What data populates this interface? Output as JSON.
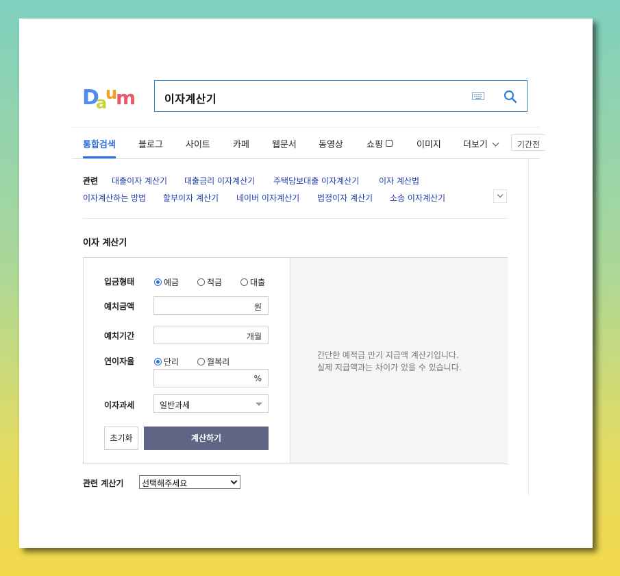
{
  "logo": {
    "text": "Daum",
    "colors": [
      "#4f8bf0",
      "#c9d43a",
      "#f0a020",
      "#4f8bf0",
      "#e85a6b"
    ]
  },
  "search": {
    "query": "이자계산기",
    "keyboard_icon": "keyboard-icon",
    "search_icon": "search-icon",
    "accent": "#2f86c9"
  },
  "tabs": [
    {
      "label": "통합검색",
      "active": true
    },
    {
      "label": "블로그"
    },
    {
      "label": "사이트"
    },
    {
      "label": "카페"
    },
    {
      "label": "웹문서"
    },
    {
      "label": "동영상"
    },
    {
      "label": "쇼핑"
    },
    {
      "label": "이미지"
    },
    {
      "label": "더보기"
    }
  ],
  "period_label": "기간전",
  "related": {
    "title": "관련",
    "links": [
      "대출이자 계산기",
      "대출금리 이자계산기",
      "주택담보대출 이자계산기",
      "이자 계산법",
      "이자계산하는 방법",
      "할부이자 계산기",
      "네이버 이자계산기",
      "법정이자 계산기",
      "소송 이자계산기"
    ]
  },
  "calculator": {
    "title": "이자 계산기",
    "deposit_type": {
      "label": "입금형태",
      "options": [
        "예금",
        "적금",
        "대출"
      ],
      "selected": "예금"
    },
    "amount": {
      "label": "예치금액",
      "value": "",
      "unit": "원"
    },
    "period": {
      "label": "예치기간",
      "value": "",
      "unit": "개월"
    },
    "rate": {
      "label": "연이자율",
      "options": [
        "단리",
        "월복리"
      ],
      "selected": "단리",
      "value": "",
      "unit": "%"
    },
    "tax": {
      "label": "이자과세",
      "selected": "일반과세"
    },
    "reset_label": "초기화",
    "calc_label": "계산하기",
    "message_line1": "간단한 예적금 만기 지급액 계산기입니다.",
    "message_line2": "실제 지급액과는 차이가 있을 수 있습니다.",
    "button_color": "#5f6585"
  },
  "related_calc": {
    "label": "관련 계산기",
    "selected": "선택해주세요"
  }
}
